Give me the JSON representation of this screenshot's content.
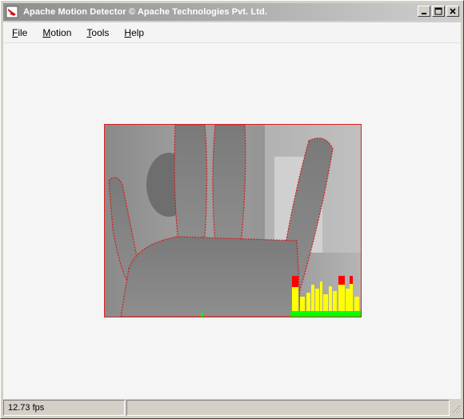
{
  "window": {
    "title": "Apache Motion Detector © Apache Technologies Pvt. Ltd.",
    "icon": "app-logo-icon"
  },
  "title_buttons": [
    "minimize-icon",
    "maximize-icon",
    "close-icon"
  ],
  "menu": {
    "items": [
      {
        "label": "File",
        "underline": "F",
        "rest": "ile"
      },
      {
        "label": "Motion",
        "underline": "M",
        "rest": "otion"
      },
      {
        "label": "Tools",
        "underline": "T",
        "rest": "ools"
      },
      {
        "label": "Help",
        "underline": "H",
        "rest": "elp"
      }
    ]
  },
  "video": {
    "content": "camera-feed",
    "border_color": "#e02020",
    "motion_colors": {
      "low": "#00ff00",
      "mid": "#ffff00",
      "high": "#ff0000"
    }
  },
  "status": {
    "fps": "12.73 fps",
    "message": ""
  }
}
